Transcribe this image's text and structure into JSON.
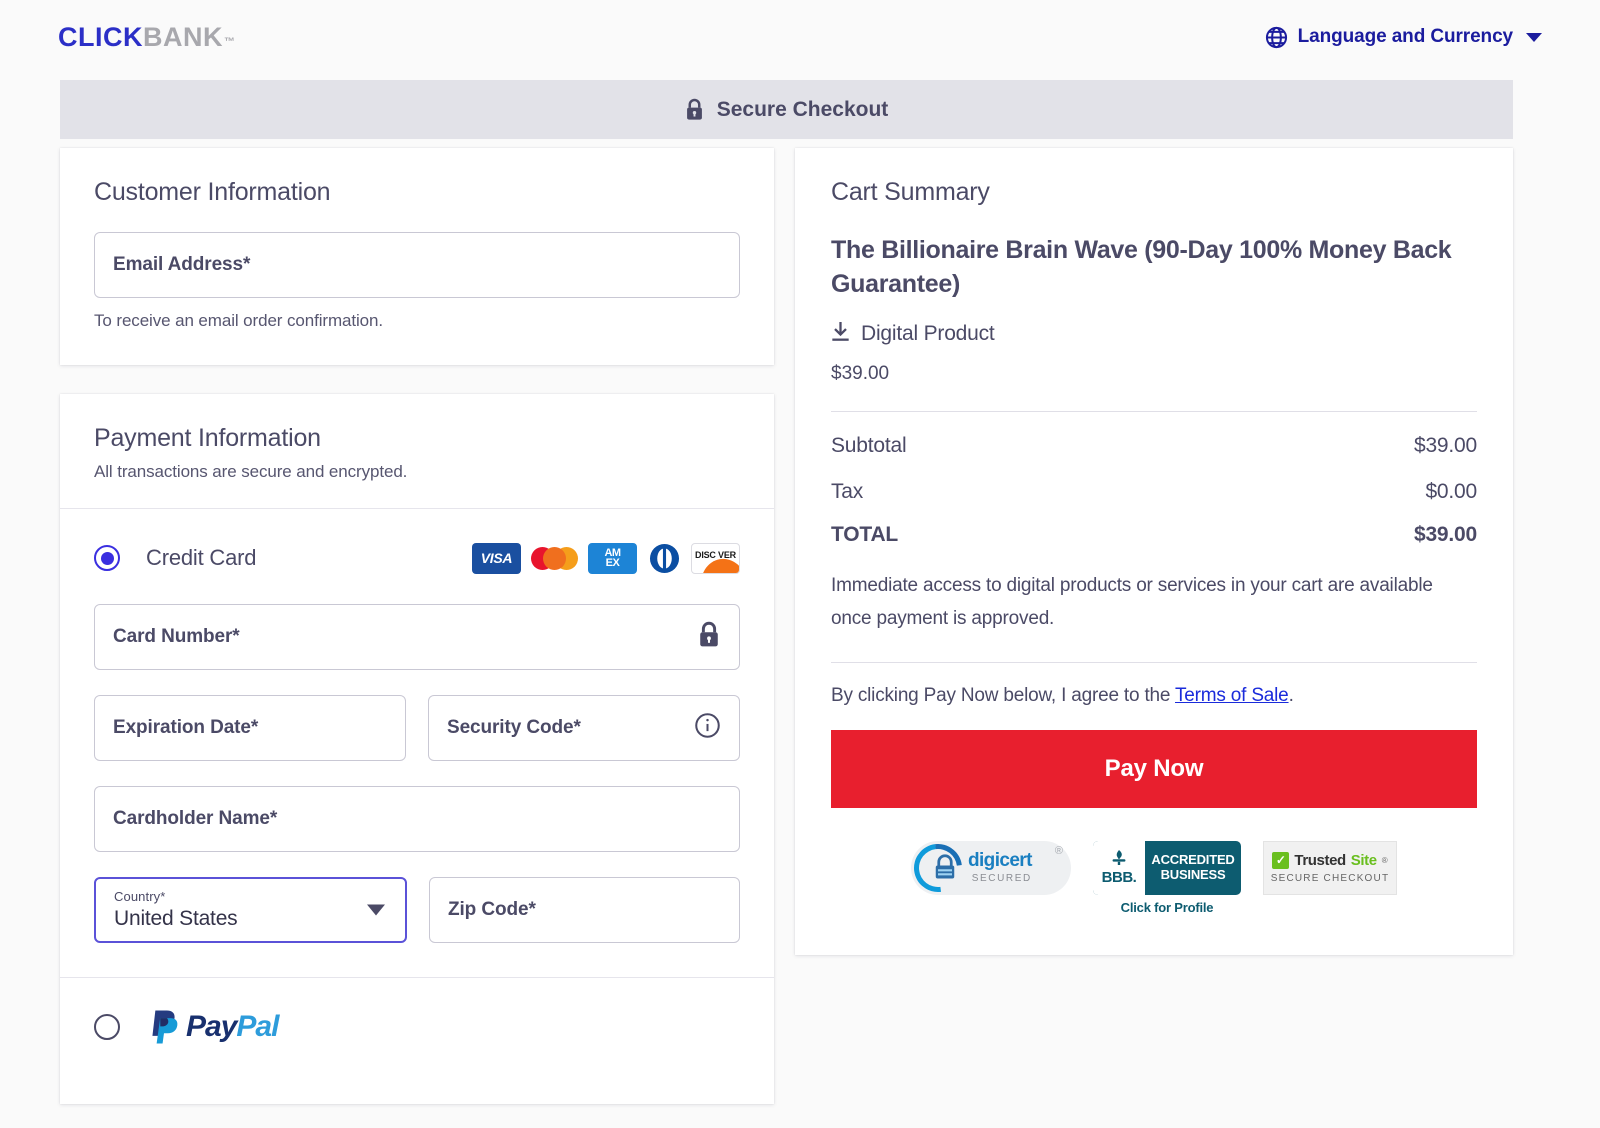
{
  "header": {
    "logo_click": "CLICK",
    "logo_bank": "BANK",
    "logo_tm": "™",
    "globe_icon": "globe-icon",
    "language_label": "Language and Currency",
    "caret_icon": "chevron-down-icon"
  },
  "secure_bar": {
    "lock_icon": "lock-icon",
    "label": "Secure Checkout"
  },
  "customer": {
    "title": "Customer Information",
    "email_placeholder": "Email Address*",
    "helper": "To receive an email order confirmation."
  },
  "payment": {
    "title": "Payment Information",
    "subtitle": "All transactions are secure and encrypted.",
    "credit_card_label": "Credit Card",
    "brands": [
      "VISA",
      "Mastercard",
      "AMEX",
      "Diners Club",
      "DISCOVER"
    ],
    "brand_visa_text": "VISA",
    "brand_amex_line1": "AM",
    "brand_amex_line2": "EX",
    "brand_discover_text": "DISC VER",
    "card_number_placeholder": "Card Number*",
    "card_lock_icon": "lock-icon",
    "expiration_placeholder": "Expiration Date*",
    "security_placeholder": "Security Code*",
    "security_info_icon": "info-icon",
    "cardholder_placeholder": "Cardholder Name*",
    "country_label": "Country*",
    "country_value": "United States",
    "country_caret_icon": "chevron-down-icon",
    "zip_placeholder": "Zip Code*",
    "paypal_pay": "Pay",
    "paypal_pal": "Pal"
  },
  "cart": {
    "title": "Cart Summary",
    "product_name": "The Billionaire Brain Wave (90-Day 100% Money Back Guarantee)",
    "delivery_icon": "download-icon",
    "delivery_type": "Digital Product",
    "product_price": "$39.00",
    "subtotal_label": "Subtotal",
    "subtotal_value": "$39.00",
    "tax_label": "Tax",
    "tax_value": "$0.00",
    "total_label": "TOTAL",
    "total_value": "$39.00",
    "access_note": "Immediate access to digital products or services in your cart are available once payment is approved.",
    "terms_prefix": "By clicking Pay Now below, I agree to the ",
    "terms_link": "Terms of Sale",
    "terms_suffix": ".",
    "pay_now_label": "Pay Now"
  },
  "badges": {
    "digicert_name": "digicert",
    "digicert_reg": "®",
    "digicert_sub": "SECURED",
    "bbb_letters": "BBB.",
    "bbb_line1": "ACCREDITED",
    "bbb_line2": "BUSINESS",
    "bbb_click": "Click for Profile",
    "trusted_check": "✓",
    "trusted_word1": "Trusted",
    "trusted_word2": "Site",
    "trusted_reg": "®",
    "trusted_sub": "SECURE CHECKOUT"
  },
  "colors": {
    "brand_blue": "#1b1c9e",
    "accent_indigo": "#3a2fe0",
    "pay_now_red": "#e81f2e",
    "link_blue": "#1a2bdb",
    "text_slate": "#4b4a66",
    "bar_gray": "#e2e2e8"
  }
}
